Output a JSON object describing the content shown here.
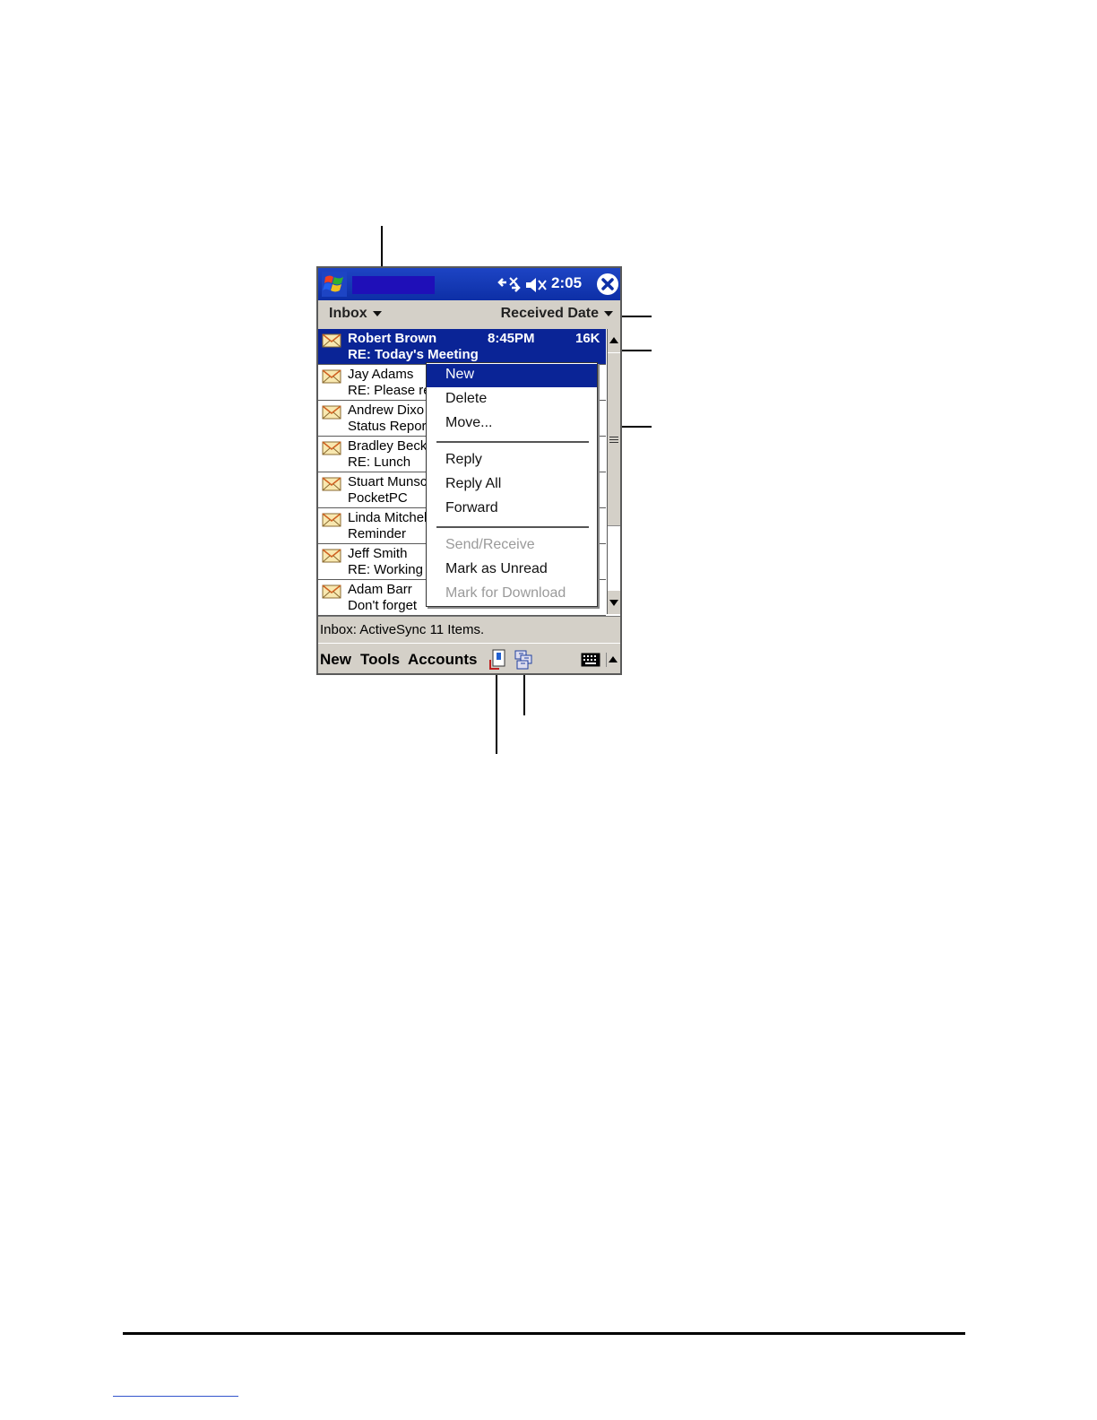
{
  "titlebar": {
    "time": "2:05"
  },
  "filterbar": {
    "folder": "Inbox",
    "sort": "Received Date"
  },
  "messages": [
    {
      "from": "Robert Brown",
      "subject": "RE: Today's Meeting",
      "time": "8:45PM",
      "size": "16K",
      "selected": true
    },
    {
      "from": "Jay Adams",
      "subject": "RE: Please re"
    },
    {
      "from": "Andrew Dixo",
      "subject": "Status Repor"
    },
    {
      "from": "Bradley Beck",
      "subject": "RE: Lunch"
    },
    {
      "from": "Stuart Munsc",
      "subject": "PocketPC"
    },
    {
      "from": "Linda Mitchel",
      "subject": "Reminder"
    },
    {
      "from": "Jeff Smith",
      "subject": "RE: Working"
    },
    {
      "from": "Adam Barr",
      "subject": "Don't forget"
    }
  ],
  "context_menu": {
    "items": [
      {
        "label": "New",
        "state": "highlighted"
      },
      {
        "label": "Delete",
        "state": "enabled"
      },
      {
        "label": "Move...",
        "state": "enabled"
      },
      {
        "label": "Reply",
        "state": "enabled"
      },
      {
        "label": "Reply All",
        "state": "enabled"
      },
      {
        "label": "Forward",
        "state": "enabled"
      },
      {
        "label": "Send/Receive",
        "state": "disabled"
      },
      {
        "label": "Mark as Unread",
        "state": "enabled"
      },
      {
        "label": "Mark for Download",
        "state": "disabled"
      }
    ]
  },
  "statusbar": {
    "text": "Inbox: ActiveSync  11 Items."
  },
  "menubar": {
    "new": "New",
    "tools": "Tools",
    "accounts": "Accounts"
  },
  "icons": {
    "start": "windows-flag-icon",
    "connectivity": "connectivity-icon",
    "speaker": "speaker-muted-icon",
    "close": "close-icon",
    "envelope": "envelope-icon",
    "send_receive": "send-receive-icon",
    "folder_list": "folder-list-icon",
    "keyboard": "keyboard-icon"
  },
  "colors": {
    "titlebar": "#0d2fa6",
    "selection": "#0a2496",
    "chrome": "#d4d0c8",
    "disabled_text": "#9a9a9a"
  }
}
